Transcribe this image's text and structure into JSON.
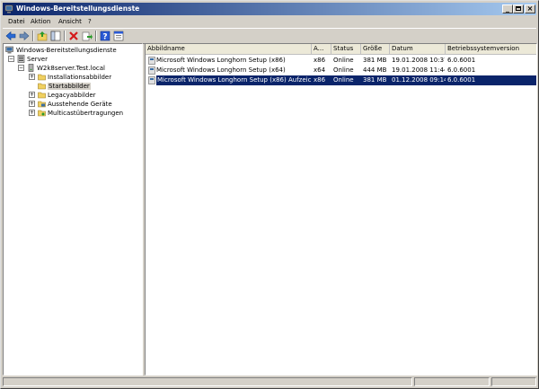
{
  "window": {
    "title": "Windows-Bereitstellungsdienste"
  },
  "menu": [
    "Datei",
    "Aktion",
    "Ansicht",
    "?"
  ],
  "toolbar": [
    "back-icon",
    "forward-icon",
    "up-folder-icon",
    "show-tree-icon",
    "delete-icon",
    "export-icon",
    "help-icon",
    "properties-icon"
  ],
  "tree": {
    "root": "Windows-Bereitstellungsdienste",
    "server": "Server",
    "host": "W2k8server.Test.local",
    "items": [
      "Installationsabbilder",
      "Startabbilder",
      "Legacyabbilder",
      "Ausstehende Geräte",
      "Multicastübertragungen"
    ]
  },
  "list": {
    "columns": [
      "Abbildname",
      "A...",
      "Status",
      "Größe",
      "Datum",
      "Betriebssystemversion"
    ],
    "rows": [
      [
        "Microsoft Windows Longhorn Setup (x86)",
        "x86",
        "Online",
        "381 MB",
        "19.01.2008 10:37",
        "6.0.6001"
      ],
      [
        "Microsoft Windows Longhorn Setup (x64)",
        "x64",
        "Online",
        "444 MB",
        "19.01.2008 11:44",
        "6.0.6001"
      ],
      [
        "Microsoft Windows Longhorn Setup (x86) Aufzeichnung",
        "x86",
        "Online",
        "381 MB",
        "01.12.2008 09:14",
        "6.0.6001"
      ]
    ]
  },
  "colors": {
    "title_start": "#0a246a",
    "title_end": "#a6caf0",
    "selection": "#0a246a",
    "face": "#d4d0c8"
  }
}
